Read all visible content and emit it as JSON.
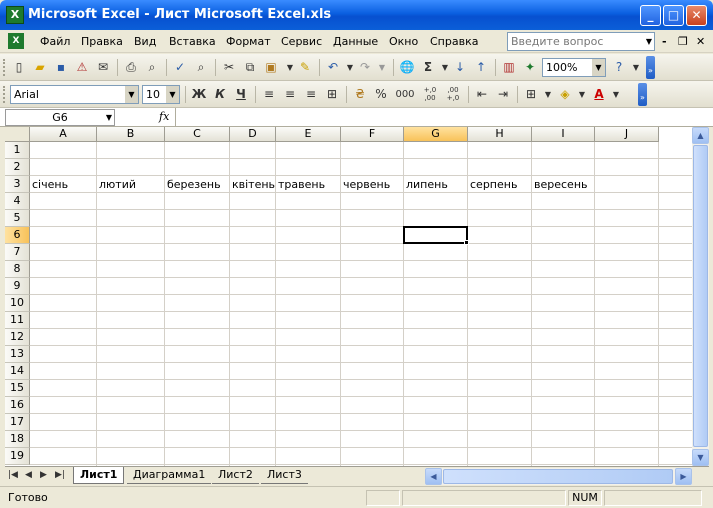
{
  "window": {
    "title": "Microsoft Excel - Лист Microsoft Excel.xls"
  },
  "menu": {
    "items": [
      "Файл",
      "Правка",
      "Вид",
      "Вставка",
      "Формат",
      "Сервис",
      "Данные",
      "Окно",
      "Справка"
    ],
    "help_placeholder": "Введите вопрос"
  },
  "toolbar": {
    "zoom": "100%",
    "font": "Arial",
    "size": "10",
    "bold": "Ж",
    "italic": "К",
    "underline": "Ч",
    "percent": "%",
    "thousands": "000",
    "inc_decimal": "+,0 ,00",
    "dec_decimal": ",00 +,0",
    "sum": "Σ",
    "fx": "fx"
  },
  "formula_bar": {
    "name_box": "G6",
    "value": ""
  },
  "grid": {
    "columns": [
      "A",
      "B",
      "C",
      "D",
      "E",
      "F",
      "G",
      "H",
      "I",
      "J"
    ],
    "rows": [
      "1",
      "2",
      "3",
      "4",
      "5",
      "6",
      "7",
      "8",
      "9",
      "10",
      "11",
      "12",
      "13",
      "14",
      "15",
      "16",
      "17",
      "18",
      "19"
    ],
    "active_column": "G",
    "active_row": "6",
    "row3": [
      "січень",
      "лютий",
      "березень",
      "квітень",
      "травень",
      "червень",
      "липень",
      "серпень",
      "вересень",
      ""
    ]
  },
  "sheets": {
    "tabs": [
      "Лист1",
      "Диаграмма1",
      "Лист2",
      "Лист3"
    ],
    "active": "Лист1"
  },
  "status": {
    "text": "Готово",
    "num": "NUM"
  },
  "colors": {
    "title_bar": "#0a5fe0",
    "active_header": "#f8c25a",
    "excel_green": "#1e7a2e"
  }
}
